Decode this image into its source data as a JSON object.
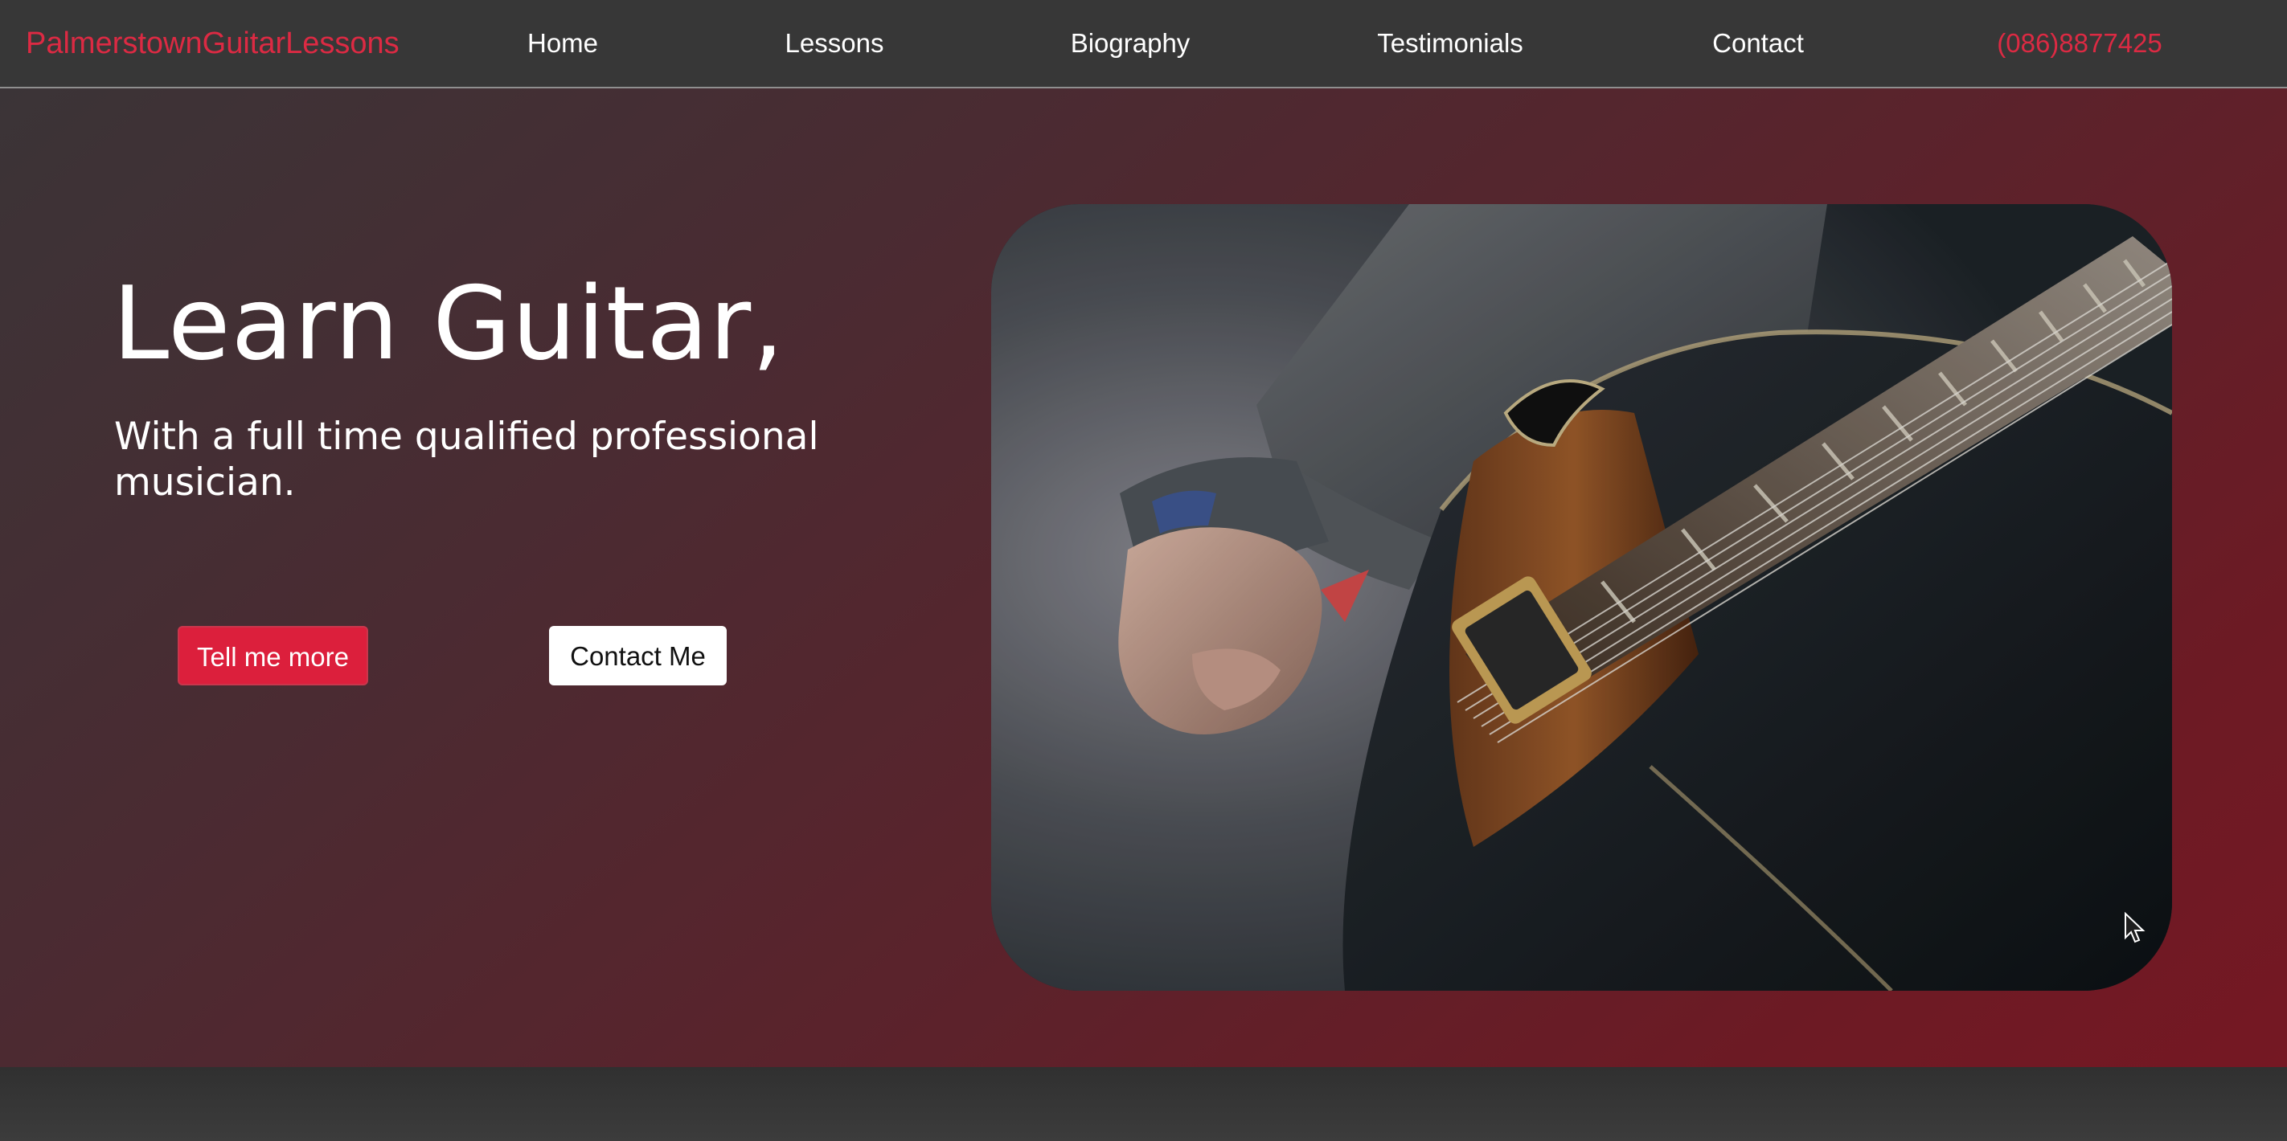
{
  "navbar": {
    "brand": "PalmerstownGuitarLessons",
    "links": [
      {
        "label": "Home"
      },
      {
        "label": "Lessons"
      },
      {
        "label": "Biography"
      },
      {
        "label": "Testimonials"
      },
      {
        "label": "Contact"
      }
    ],
    "phone": "(086)8877425"
  },
  "hero": {
    "title": "Learn Guitar,",
    "subtitle": "With a full time qualified professional musician.",
    "primary_button": "Tell me more",
    "secondary_button": "Contact Me",
    "image_subject": "guitarist-playing-archtop-guitar-photo"
  },
  "colors": {
    "accent": "#dc2a43",
    "navbar_bg": "#373737",
    "button_primary": "#dc1f3c",
    "hero_gradient_start": "#3b3437",
    "hero_gradient_end": "#751823"
  },
  "icons": {
    "cursor": "arrow-cursor-icon"
  }
}
